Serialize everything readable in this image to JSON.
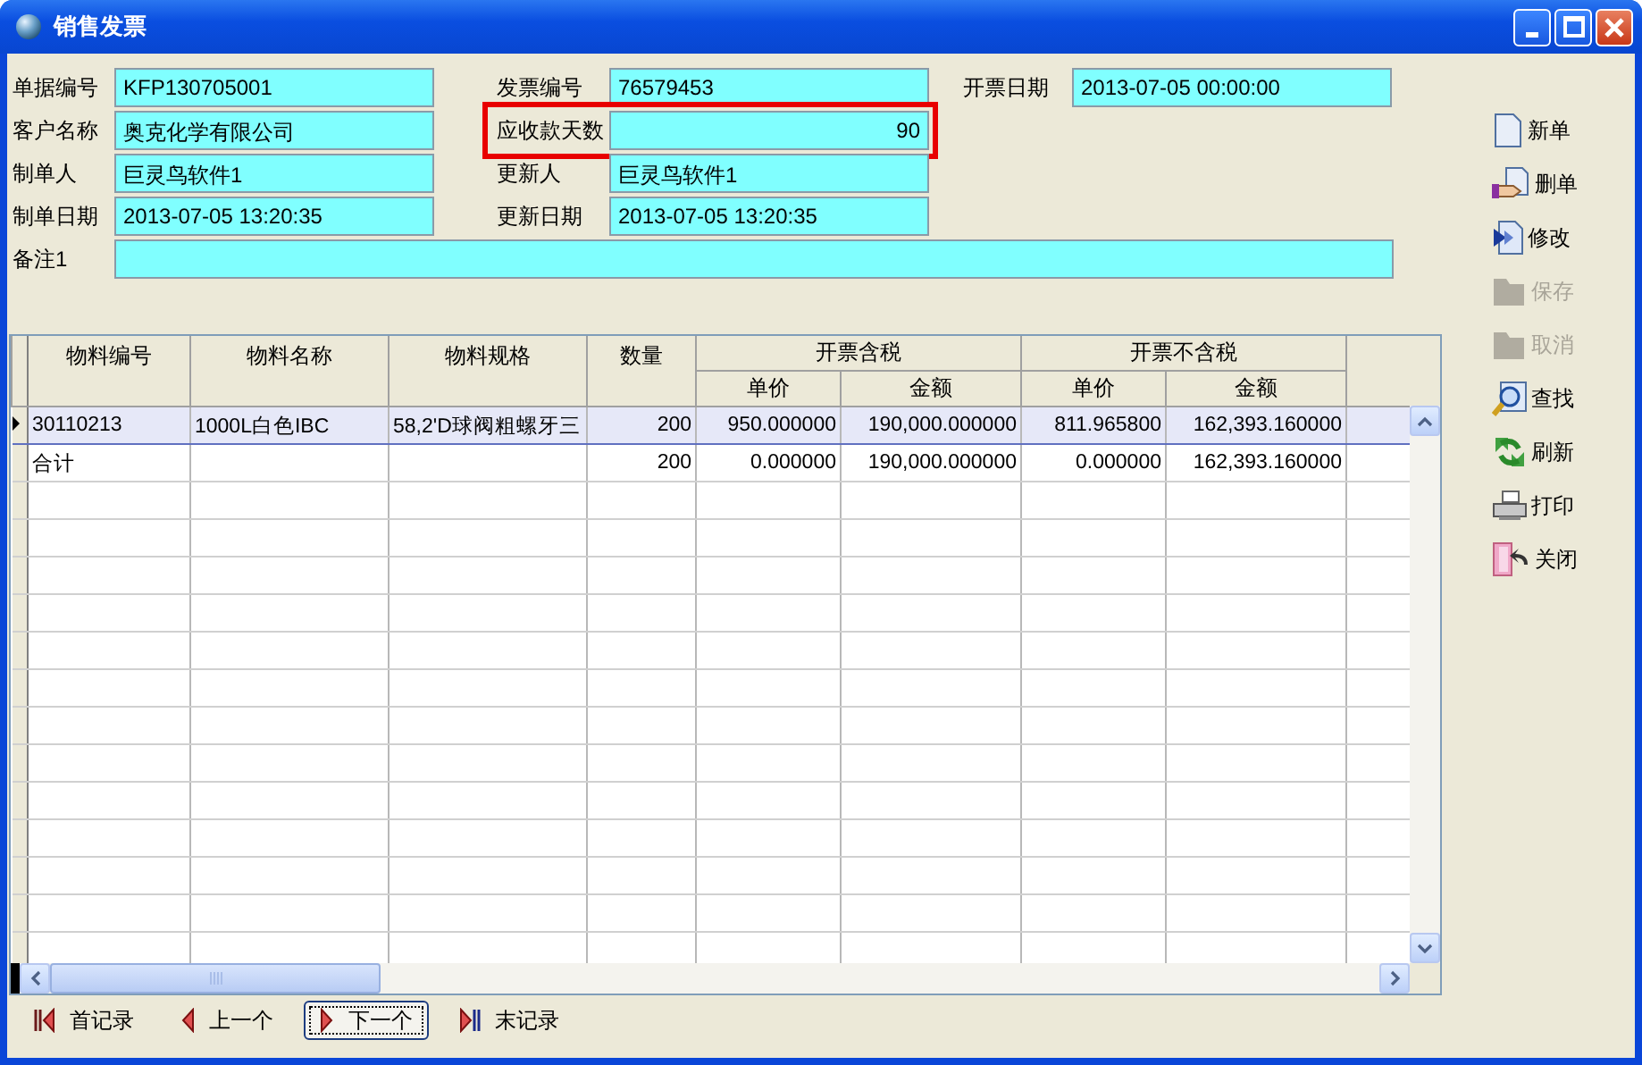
{
  "window": {
    "title": "销售发票"
  },
  "form": {
    "rows": [
      [
        {
          "label": "单据编号",
          "value": "KFP130705001",
          "kind": "text",
          "highlighted": false
        },
        {
          "label": "发票编号",
          "value": "76579453",
          "kind": "text",
          "highlighted": false
        },
        {
          "label": "开票日期",
          "value": "2013-07-05 00:00:00",
          "kind": "text",
          "highlighted": false
        }
      ],
      [
        {
          "label": "客户名称",
          "value": "奥克化学有限公司",
          "kind": "text",
          "highlighted": false
        },
        {
          "label": "应收款天数",
          "value": "90",
          "kind": "number",
          "highlighted": true
        }
      ],
      [
        {
          "label": "制单人",
          "value": "巨灵鸟软件1",
          "kind": "text",
          "highlighted": false
        },
        {
          "label": "更新人",
          "value": "巨灵鸟软件1",
          "kind": "text",
          "highlighted": false
        }
      ],
      [
        {
          "label": "制单日期",
          "value": "2013-07-05 13:20:35",
          "kind": "text",
          "highlighted": false
        },
        {
          "label": "更新日期",
          "value": "2013-07-05 13:20:35",
          "kind": "text",
          "highlighted": false
        }
      ],
      [
        {
          "label": "备注1",
          "kind": "memo",
          "highlighted": false
        }
      ]
    ]
  },
  "table": {
    "columns": [
      {
        "label": "物料编号"
      },
      {
        "label": "物料名称"
      },
      {
        "label": "物料规格"
      },
      {
        "label": "数量"
      },
      {
        "label": "开票含税",
        "colspan": 2,
        "children": [
          {
            "label": "单价"
          },
          {
            "label": "金额"
          }
        ]
      },
      {
        "label": "开票不含税",
        "colspan": 2,
        "children": [
          {
            "label": "单价"
          },
          {
            "label": "金额"
          }
        ]
      }
    ],
    "rows": [
      {
        "selected": true,
        "cells": [
          "30110213",
          "1000L白色IBC",
          "58,2'D球阀粗螺牙三",
          "200",
          "950.000000",
          "190,000.000000",
          "811.965800",
          "162,393.160000"
        ]
      },
      {
        "selected": false,
        "cells": [
          "合计",
          null,
          null,
          "200",
          "0.000000",
          "190,000.000000",
          "0.000000",
          "162,393.160000"
        ]
      }
    ]
  },
  "toolbar": [
    {
      "label": "新单",
      "disabled": false
    },
    {
      "label": "删单",
      "disabled": false
    },
    {
      "label": "修改",
      "disabled": false
    },
    {
      "label": "保存",
      "disabled": true
    },
    {
      "label": "取消",
      "disabled": true
    },
    {
      "label": "查找",
      "disabled": false
    },
    {
      "label": "刷新",
      "disabled": false
    },
    {
      "label": "打印",
      "disabled": false
    },
    {
      "label": "关闭",
      "disabled": false
    }
  ],
  "navigation": [
    {
      "label": "首记录",
      "focused": false
    },
    {
      "label": "上一个",
      "focused": false
    },
    {
      "label": "下一个",
      "focused": true
    },
    {
      "label": "末记录",
      "focused": false
    }
  ]
}
